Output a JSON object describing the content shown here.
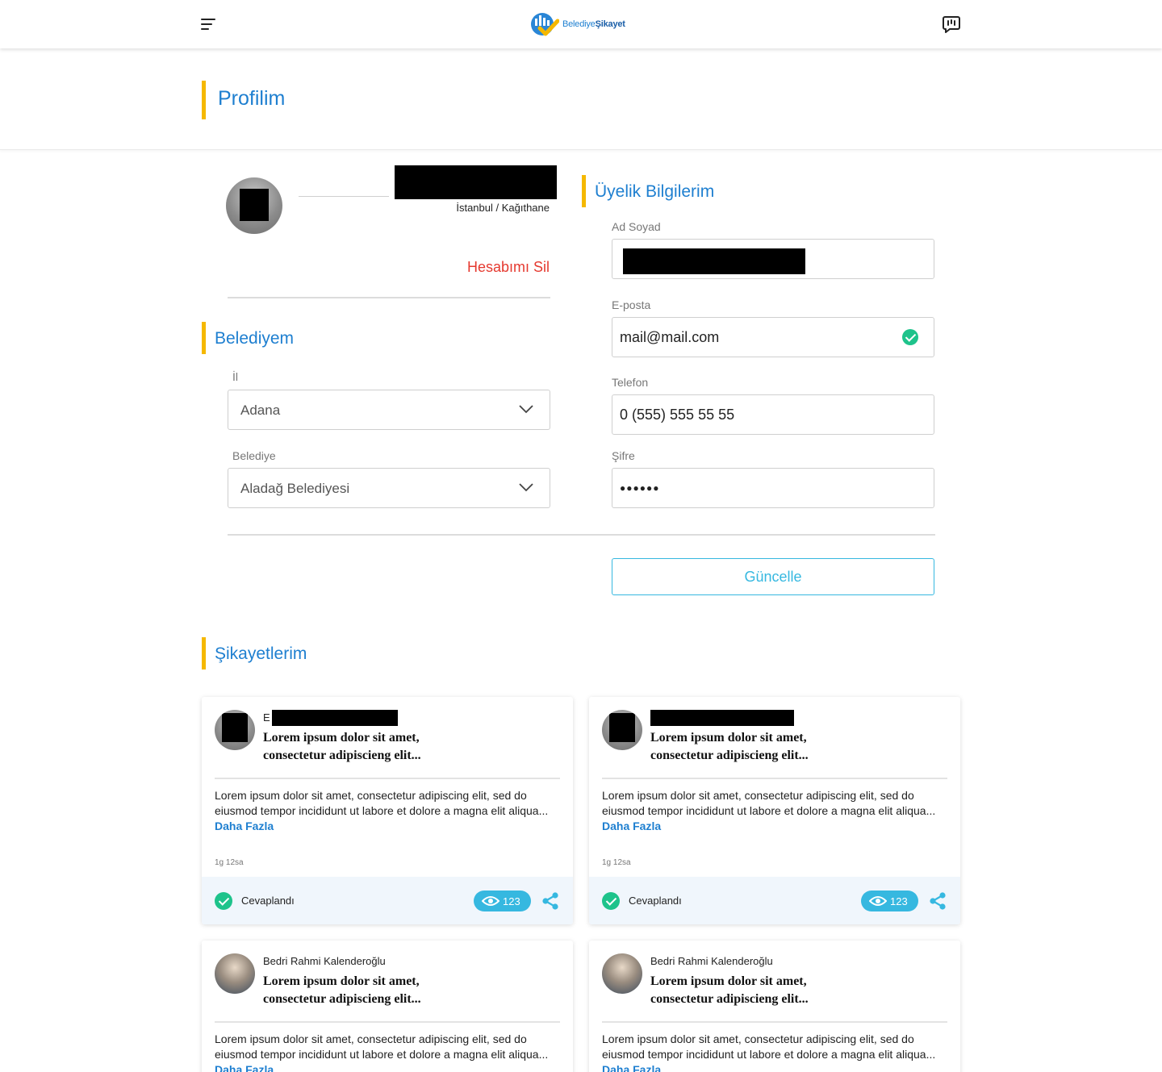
{
  "header": {
    "logo_prefix": "Belediye",
    "logo_brand": "Şikayet"
  },
  "page": {
    "title": "Profilim"
  },
  "profile": {
    "location": "İstanbul / Kağıthane",
    "delete_account": "Hesabımı Sil"
  },
  "municipality": {
    "section_title": "Belediyem",
    "province_label": "İl",
    "province_value": "Adana",
    "municipality_label": "Belediye",
    "municipality_value": "Aladağ Belediyesi"
  },
  "membership": {
    "section_title": "Üyelik Bilgilerim",
    "name_label": "Ad Soyad",
    "email_label": "E-posta",
    "email_value": "mail@mail.com",
    "phone_label": "Telefon",
    "phone_value": "0 (555) 555 55 55",
    "password_label": "Şifre",
    "password_value": "●●●●●●",
    "update_button": "Güncelle"
  },
  "complaints": {
    "section_title": "Şikayetlerim",
    "cards": [
      {
        "author": "E",
        "title_line1": "Lorem ipsum dolor sit amet,",
        "title_line2": "consectetur adipiscieng elit...",
        "body": "Lorem ipsum dolor sit amet, consectetur adipiscing elit, sed do eiusmod tempor incididunt ut labore et dolore a magna elit aliqua... ",
        "more": "Daha Fazla",
        "time": "1g 12sa",
        "status": "Cevaplandı",
        "views": "123"
      },
      {
        "author": "",
        "title_line1": "Lorem ipsum dolor sit amet,",
        "title_line2": "consectetur adipiscieng elit...",
        "body": "Lorem ipsum dolor sit amet, consectetur adipiscing elit, sed do eiusmod tempor incididunt ut labore et dolore a magna elit aliqua... ",
        "more": "Daha Fazla",
        "time": "1g 12sa",
        "status": "Cevaplandı",
        "views": "123"
      },
      {
        "author": "Bedri Rahmi Kalenderoğlu",
        "title_line1": "Lorem ipsum dolor sit amet,",
        "title_line2": "consectetur adipiscieng elit...",
        "body": "Lorem ipsum dolor sit amet, consectetur adipiscing elit, sed do eiusmod tempor incididunt ut labore et dolore a magna elit aliqua... ",
        "more": "Daha Fazla"
      },
      {
        "author": "Bedri Rahmi Kalenderoğlu",
        "title_line1": "Lorem ipsum dolor sit amet,",
        "title_line2": "consectetur adipiscieng elit...",
        "body": "Lorem ipsum dolor sit amet, consectetur adipiscing elit, sed do eiusmod tempor incididunt ut labore et dolore a magna elit aliqua... ",
        "more": "Daha Fazla"
      }
    ]
  },
  "colors": {
    "accent": "#f5b800",
    "brand_blue": "#1e7fd0",
    "button_cyan": "#36b8e0",
    "success_green": "#1ec38b",
    "danger_red": "#e5392f"
  }
}
